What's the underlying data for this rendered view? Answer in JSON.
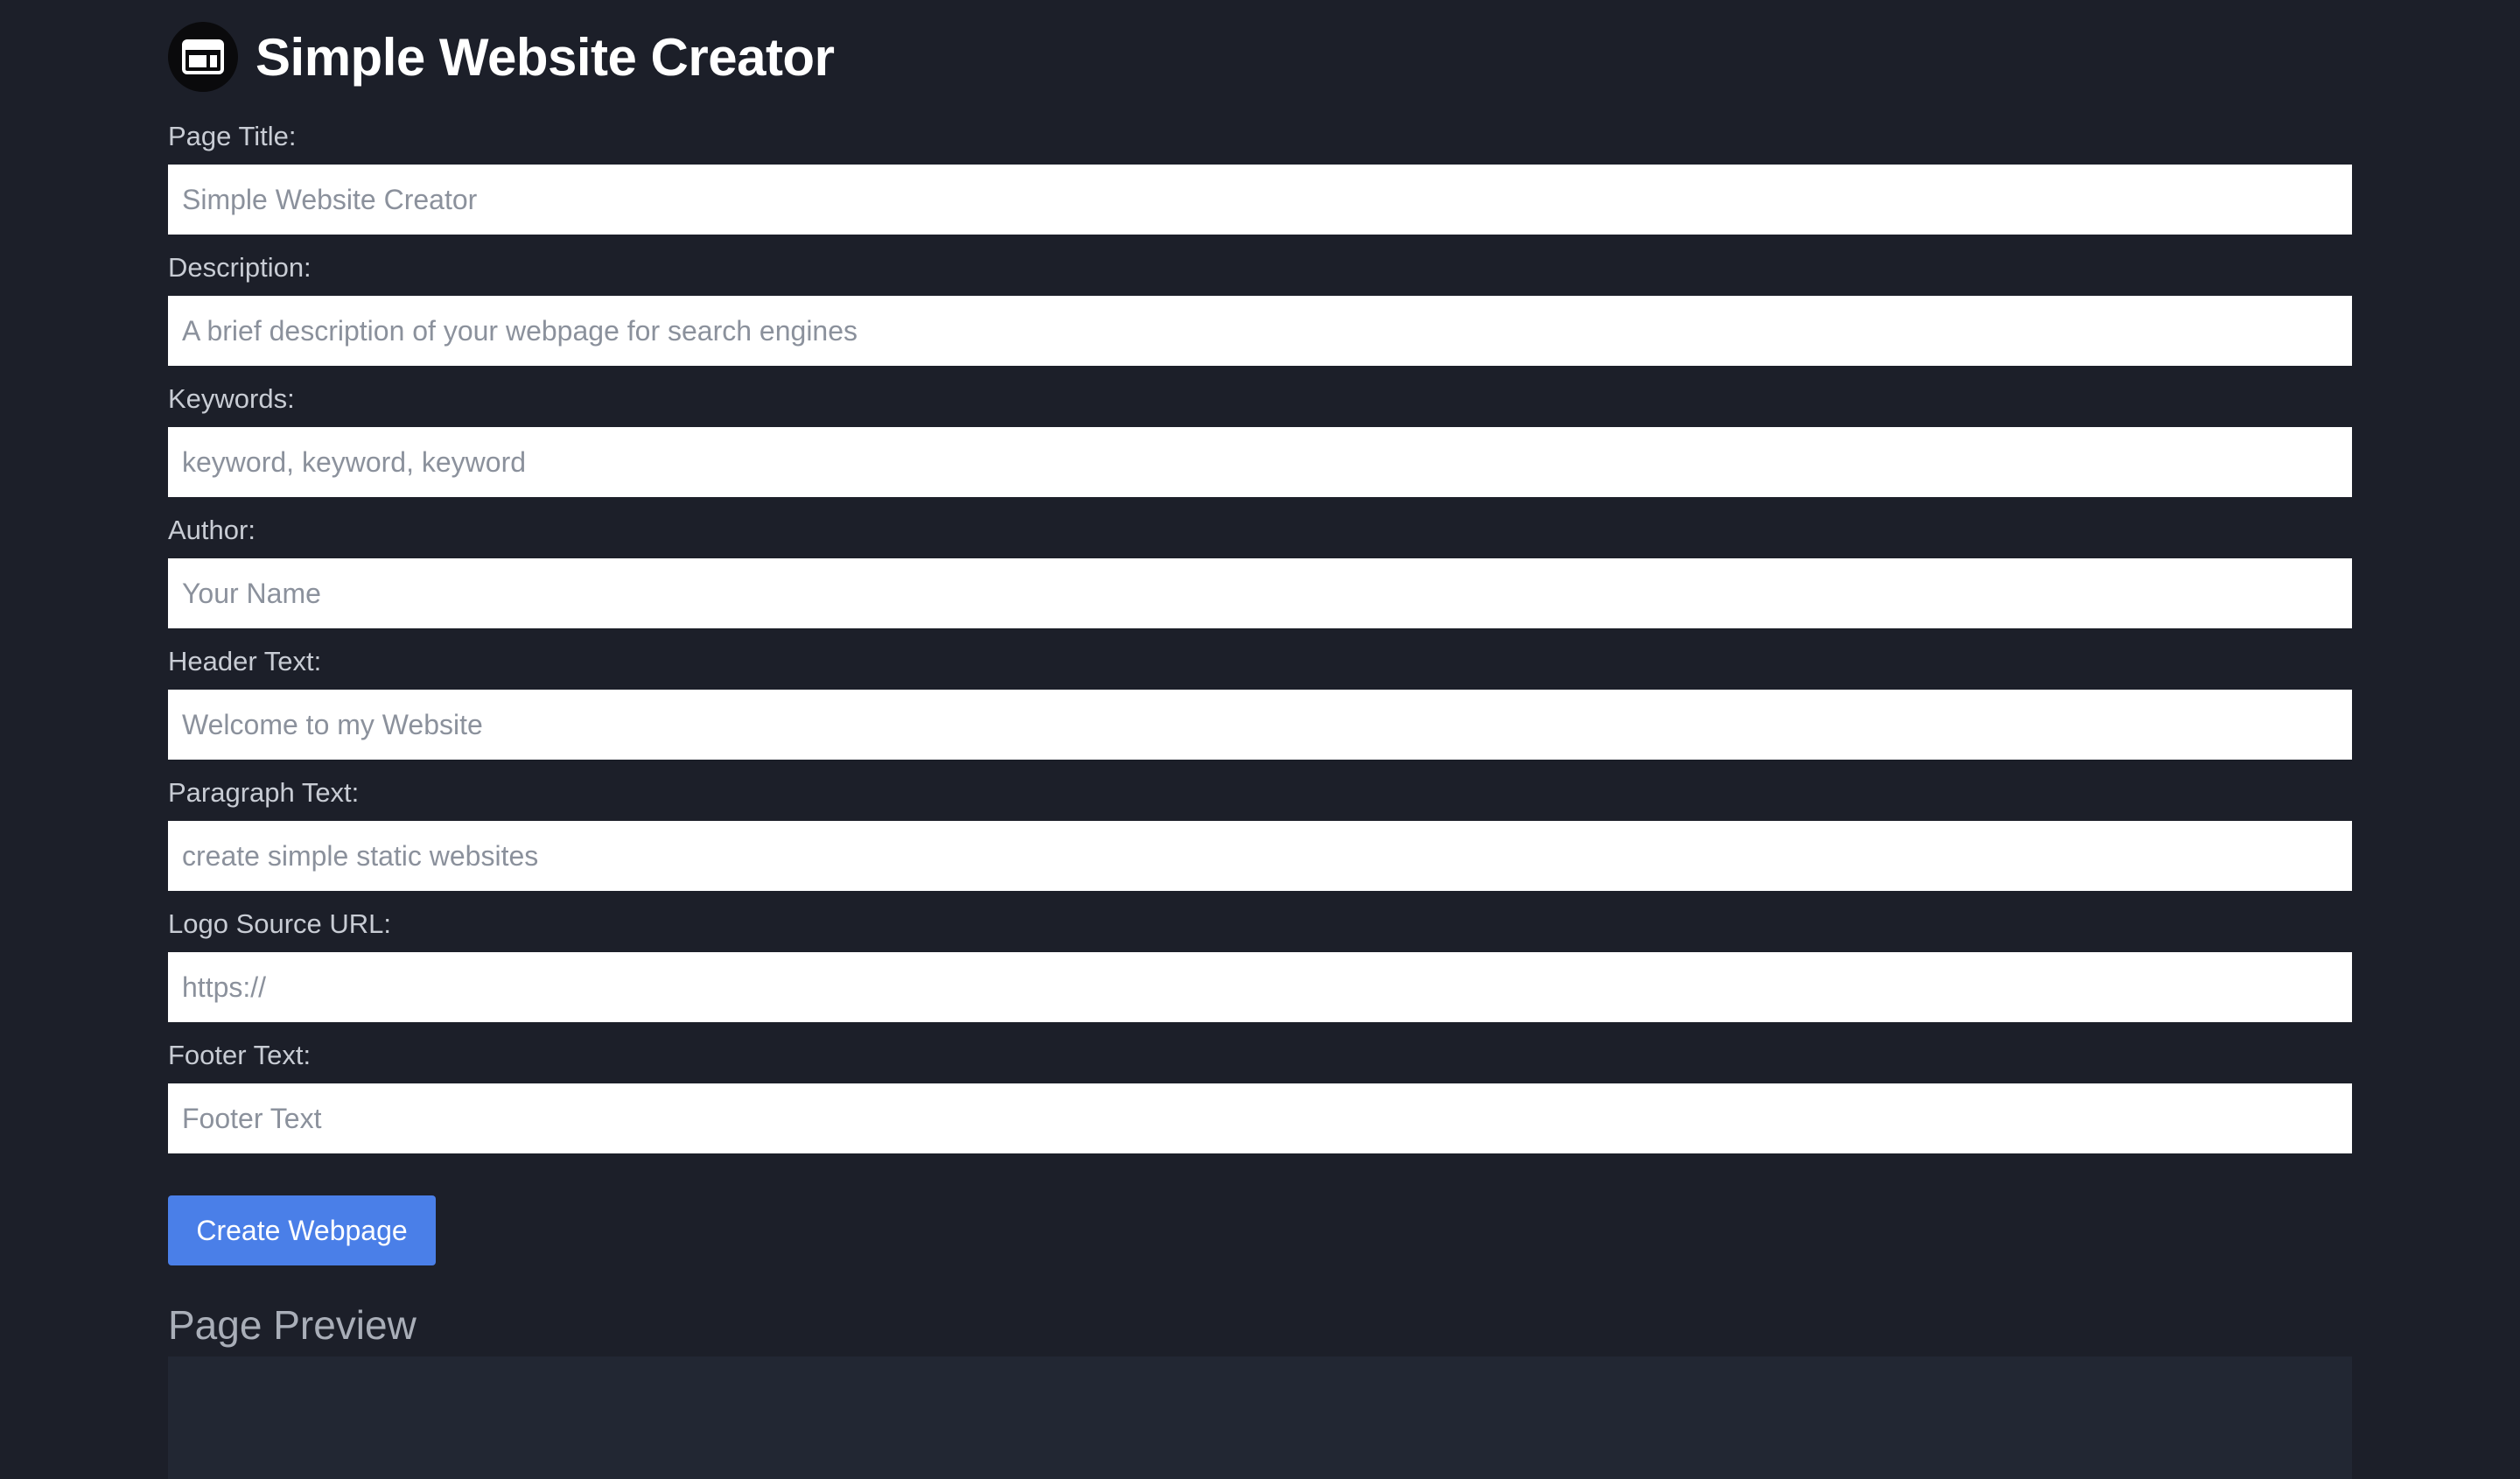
{
  "header": {
    "title": "Simple Website Creator"
  },
  "form": {
    "fields": [
      {
        "label": "Page Title:",
        "placeholder": "Simple Website Creator",
        "value": ""
      },
      {
        "label": "Description:",
        "placeholder": "A brief description of your webpage for search engines",
        "value": ""
      },
      {
        "label": "Keywords:",
        "placeholder": "keyword, keyword, keyword",
        "value": ""
      },
      {
        "label": "Author:",
        "placeholder": "Your Name",
        "value": ""
      },
      {
        "label": "Header Text:",
        "placeholder": "Welcome to my Website",
        "value": ""
      },
      {
        "label": "Paragraph Text:",
        "placeholder": "create simple static websites",
        "value": ""
      },
      {
        "label": "Logo Source URL:",
        "placeholder": "https://",
        "value": ""
      },
      {
        "label": "Footer Text:",
        "placeholder": "Footer Text",
        "value": ""
      }
    ],
    "submit_label": "Create Webpage"
  },
  "preview": {
    "title": "Page Preview"
  },
  "colors": {
    "background": "#1c1f29",
    "button": "#4a7fe8",
    "preview_panel": "#222733"
  },
  "icons": {
    "app_logo": "browser-window-icon"
  }
}
